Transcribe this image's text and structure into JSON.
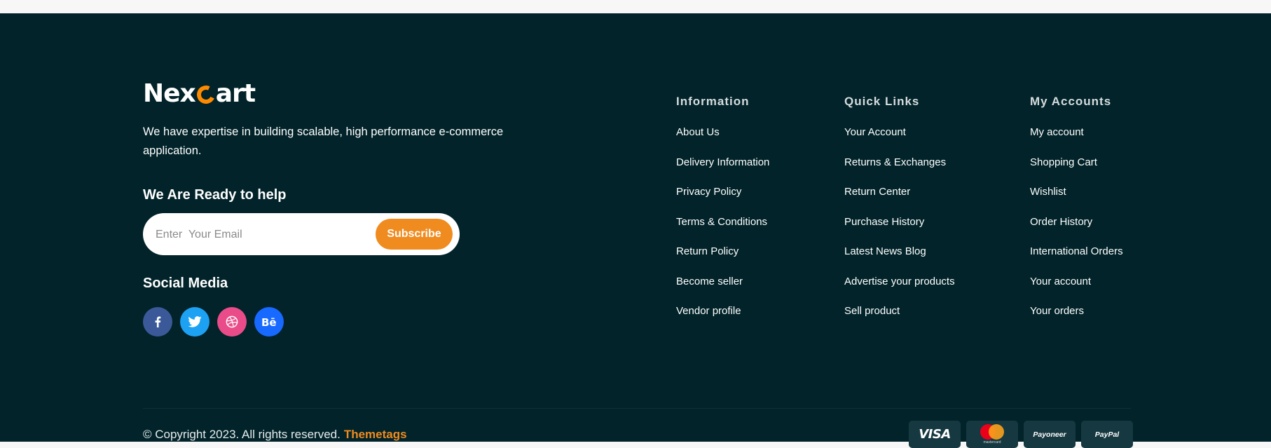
{
  "brand": {
    "name_prefix": "Nex",
    "name_suffix": "art",
    "accent_color": "#f08b1f"
  },
  "about_text": "We have expertise in building scalable, high  performance e-commerce application.",
  "newsletter": {
    "heading": "We Are Ready to help",
    "placeholder": "Enter  Your Email",
    "value": "",
    "button_label": "Subscribe"
  },
  "social": {
    "heading": "Social Media",
    "icons": [
      {
        "name": "facebook-icon",
        "color": "#3b5998"
      },
      {
        "name": "twitter-icon",
        "color": "#1da1f2"
      },
      {
        "name": "dribbble-icon",
        "color": "#ea4c89"
      },
      {
        "name": "behance-icon",
        "color": "#1769ff"
      }
    ]
  },
  "columns": [
    {
      "title": "Information",
      "links": [
        "About Us",
        "Delivery Information",
        "Privacy Policy",
        "Terms & Conditions",
        "Return Policy",
        "Become seller",
        "Vendor profile"
      ]
    },
    {
      "title": "Quick Links",
      "links": [
        "Your Account",
        "Returns & Exchanges",
        "Return Center",
        "Purchase History",
        "Latest News Blog",
        "Advertise your products",
        "Sell product"
      ]
    },
    {
      "title": "My Accounts",
      "links": [
        "My account",
        "Shopping Cart",
        "Wishlist",
        "Order History",
        "International Orders",
        "Your account",
        "Your orders"
      ]
    }
  ],
  "copyright": {
    "text": "© Copyright 2023. All rights reserved.",
    "link": "Themetags"
  },
  "payments": {
    "visa": "VISA",
    "mastercard": "mastercard",
    "payoneer": "Payoneer",
    "paypal": "PayPal"
  },
  "colors": {
    "footer_bg": "#012329",
    "payment_tile_bg": "#163840"
  }
}
